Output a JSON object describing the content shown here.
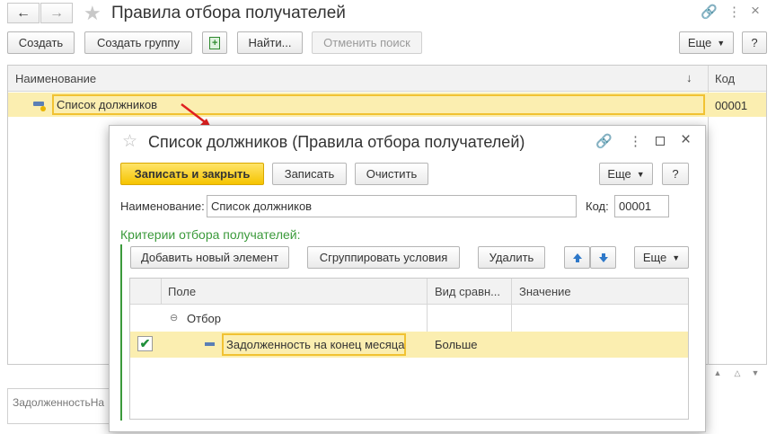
{
  "main": {
    "title": "Правила отбора получателей",
    "nav_back": "back",
    "nav_forward": "forward",
    "toolbar": {
      "create": "Создать",
      "create_group": "Создать группу",
      "find": "Найти...",
      "cancel_search": "Отменить поиск",
      "more": "Еще"
    },
    "list": {
      "col_name": "Наименование",
      "col_code": "Код",
      "sort_indicator": "↓",
      "rows": [
        {
          "name": "Список должников",
          "code": "00001"
        }
      ]
    },
    "bottom_field": "ЗадолженностьНа",
    "help": "?"
  },
  "dialog": {
    "title": "Список должников (Правила отбора получателей)",
    "buttons": {
      "save_close": "Записать и закрыть",
      "save": "Записать",
      "clear": "Очистить",
      "more": "Еще",
      "help": "?"
    },
    "name_label": "Наименование:",
    "name_value": "Список должников",
    "code_label": "Код:",
    "code_value": "00001",
    "criteria_label": "Критерии отбора получателей:",
    "criteria_buttons": {
      "add": "Добавить новый элемент",
      "group": "Сгруппировать условия",
      "delete": "Удалить",
      "more": "Еще"
    },
    "table": {
      "headers": {
        "field": "Поле",
        "comparison": "Вид сравн...",
        "value": "Значение"
      },
      "group_row": "Отбор",
      "rows": [
        {
          "checked": true,
          "field": "Задолженность на конец месяца",
          "comparison": "Больше",
          "value": ""
        }
      ]
    }
  },
  "colors": {
    "accent_yellow": "#f5c400",
    "row_highlight": "#fbeeb0",
    "criteria_green": "#3b9a3b",
    "arrow_red": "#e02020"
  }
}
